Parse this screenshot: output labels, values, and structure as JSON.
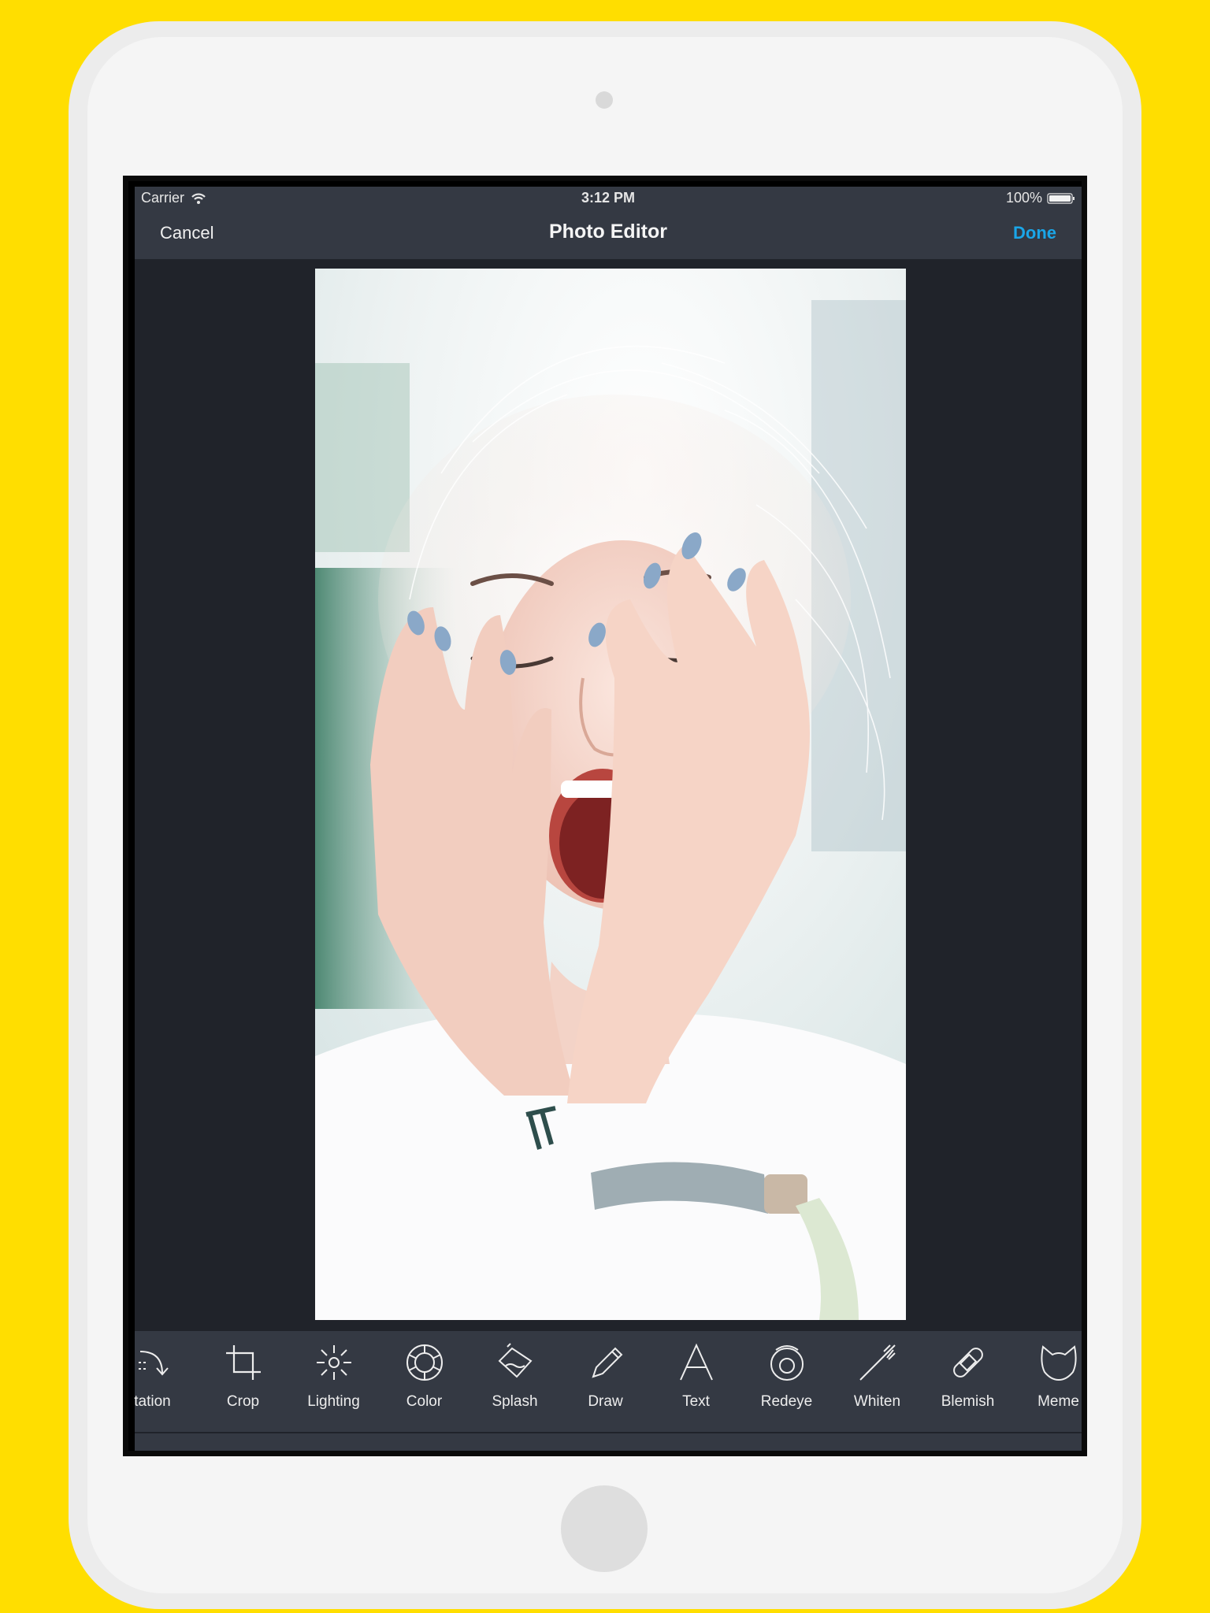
{
  "status_bar": {
    "carrier": "Carrier",
    "time": "3:12 PM",
    "battery": "100%"
  },
  "nav": {
    "cancel_label": "Cancel",
    "title": "Photo Editor",
    "done_label": "Done"
  },
  "toolbar": {
    "tools": [
      {
        "label": "tation",
        "icon": "orientation-icon"
      },
      {
        "label": "Crop",
        "icon": "crop-icon"
      },
      {
        "label": "Lighting",
        "icon": "lighting-icon"
      },
      {
        "label": "Color",
        "icon": "color-icon"
      },
      {
        "label": "Splash",
        "icon": "splash-icon"
      },
      {
        "label": "Draw",
        "icon": "draw-icon"
      },
      {
        "label": "Text",
        "icon": "text-icon"
      },
      {
        "label": "Redeye",
        "icon": "redeye-icon"
      },
      {
        "label": "Whiten",
        "icon": "whiten-icon"
      },
      {
        "label": "Blemish",
        "icon": "blemish-icon"
      },
      {
        "label": "Meme",
        "icon": "meme-icon"
      }
    ]
  },
  "colors": {
    "background": "#FFDE00",
    "nav_bar": "#343943",
    "canvas": "#20232A",
    "accent": "#1AA6E8"
  }
}
